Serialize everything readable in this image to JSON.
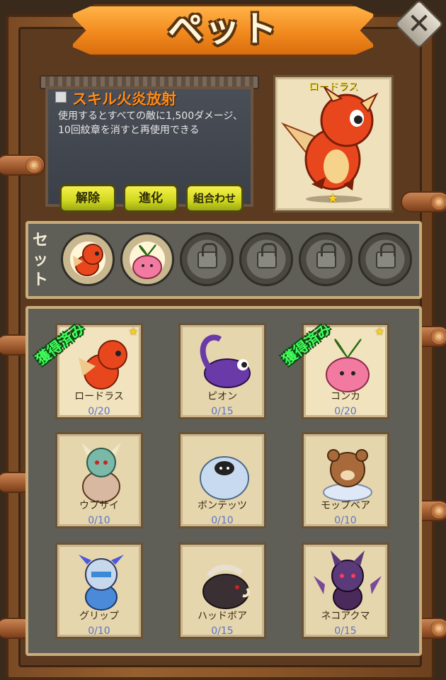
{
  "title": "ペット",
  "skill": {
    "title": "スキル火炎放射",
    "description": "使用するとすべての敵に1,500ダメージ、10回紋章を消すと再使用できる"
  },
  "buttons": {
    "release": "解除",
    "evolve": "進化",
    "combine": "組合わせ"
  },
  "preview": {
    "name": "ロードラス",
    "stars": 1
  },
  "set": {
    "label": "セット",
    "slots": [
      {
        "pet": "red-dragon",
        "locked": false
      },
      {
        "pet": "pink-radish",
        "locked": false
      },
      {
        "locked": true
      },
      {
        "locked": true
      },
      {
        "locked": true
      },
      {
        "locked": true
      }
    ]
  },
  "obtained_label": "獲得済み",
  "pets": [
    {
      "name": "ロードラス",
      "count": "0/20",
      "owned": true,
      "icon": "red-dragon-icon"
    },
    {
      "name": "ピオン",
      "count": "0/15",
      "owned": false,
      "icon": "purple-scorpion-icon"
    },
    {
      "name": "コンカ",
      "count": "0/20",
      "owned": true,
      "icon": "pink-radish-icon"
    },
    {
      "name": "ウプサイ",
      "count": "0/10",
      "owned": false,
      "icon": "minotaur-icon"
    },
    {
      "name": "ボンテッツ",
      "count": "0/10",
      "owned": false,
      "icon": "yeti-icon"
    },
    {
      "name": "モップベア",
      "count": "0/10",
      "owned": false,
      "icon": "bear-icon"
    },
    {
      "name": "グリップ",
      "count": "0/10",
      "owned": false,
      "icon": "blue-dragon-icon"
    },
    {
      "name": "ハッドボア",
      "count": "0/15",
      "owned": false,
      "icon": "boar-icon"
    },
    {
      "name": "ネコアクマ",
      "count": "0/15",
      "owned": false,
      "icon": "cat-demon-icon"
    }
  ],
  "colors": {
    "accent": "#f28a1e",
    "obtained": "#42ff5c",
    "button": "#dfe12a",
    "count": "#5a74c8"
  }
}
